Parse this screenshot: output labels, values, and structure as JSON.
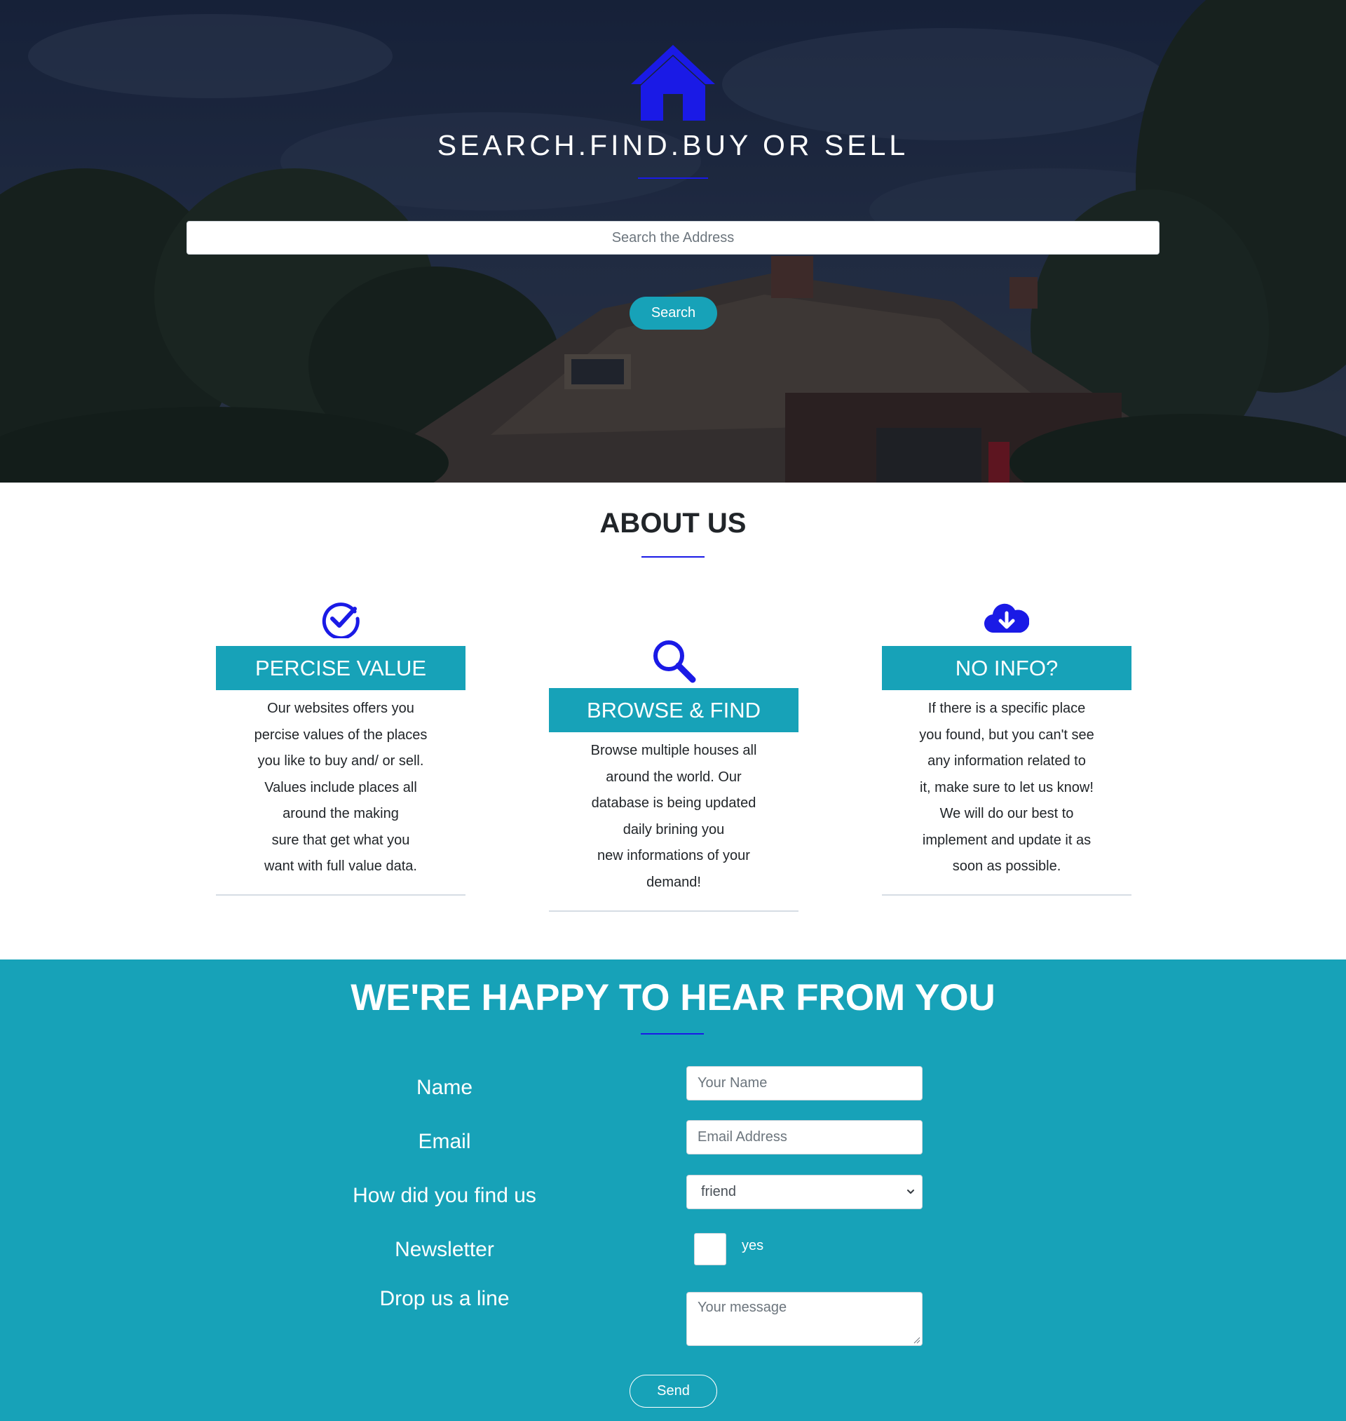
{
  "colors": {
    "accent": "#17a2b8",
    "icon_blue": "#1a1ae6",
    "hero_overlay": "#1d2a45"
  },
  "hero": {
    "icon": "home-icon",
    "title": "SEARCH.FIND.BUY OR SELL",
    "search_placeholder": "Search the Address",
    "search_button": "Search"
  },
  "about": {
    "title": "ABOUT US",
    "cards": [
      {
        "icon": "check-circle-icon",
        "heading": "PERCISE VALUE",
        "lines": [
          "Our websites offers you",
          "percise values of the places",
          "you like to buy and/ or sell.",
          "Values include places all",
          "around the making",
          "sure that get what you",
          "want with full value data."
        ]
      },
      {
        "icon": "search-icon",
        "heading": "BROWSE & FIND",
        "lines": [
          "Browse multiple houses all",
          "around the world. Our",
          "database is being updated",
          "daily brining you",
          "new informations of your",
          "demand!"
        ]
      },
      {
        "icon": "cloud-download-icon",
        "heading": "NO INFO?",
        "lines": [
          "If there is a specific place",
          "you found, but you can't see",
          "any information related to",
          "it, make sure to let us know!",
          "We will do our best to",
          "implement and update it as",
          "soon as possible."
        ]
      }
    ]
  },
  "contact": {
    "title": "WE'RE HAPPY TO HEAR FROM YOU",
    "labels": {
      "name": "Name",
      "email": "Email",
      "find": "How did you find us",
      "newsletter": "Newsletter",
      "message": "Drop us a line"
    },
    "name_placeholder": "Your Name",
    "email_placeholder": "Email Address",
    "find_selected": "friend",
    "newsletter_option": "yes",
    "message_placeholder": "Your message",
    "send_button": "Send"
  }
}
